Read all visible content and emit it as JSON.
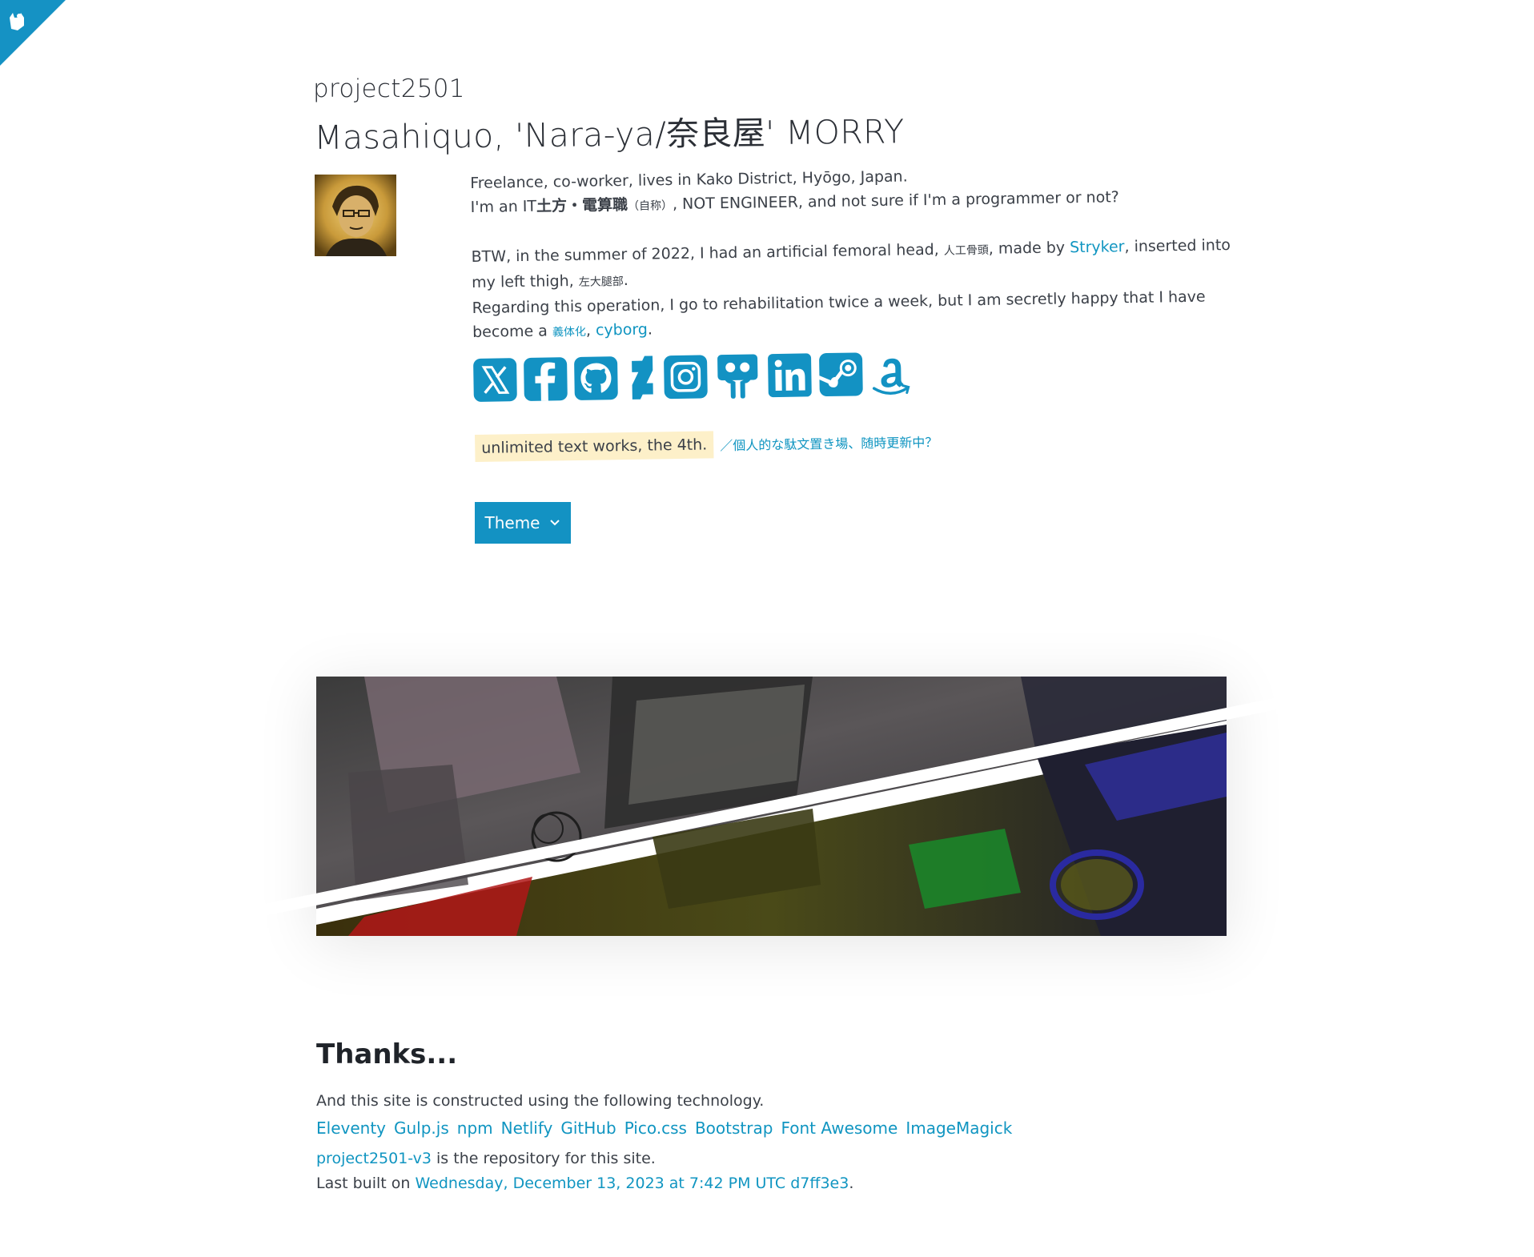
{
  "header": {
    "site_name": "project2501",
    "author_name": "Masahiquo, 'Nara-ya/奈良屋' MORRY"
  },
  "bio": {
    "line1": "Freelance, co-worker, lives in Kako District, Hyōgo, Japan.",
    "line2_a": "I'm an IT",
    "line2_jp": "土方・電算職",
    "line2_small": "（自称）",
    "line2_b": ", NOT ENGINEER, and not sure if I'm a programmer or not?",
    "line3_a": "BTW, in the summer of 2022, I had an artificial femoral head, ",
    "line3_small": "人工骨頭",
    "line3_b": ", made by ",
    "stryker_link": "Stryker",
    "line3_c": ", inserted into my left thigh, ",
    "line3_small2": "左大腿部",
    "line3_d": ".",
    "line4_a": "Regarding this operation, I go to rehabilitation twice a week, but I am secretly happy that I have become a ",
    "line4_small_link": "義体化",
    "line4_b": ", ",
    "cyborg_link": "cyborg",
    "line4_c": "."
  },
  "socials": [
    "x-icon",
    "facebook-icon",
    "github-icon",
    "deviantart-icon",
    "instagram-icon",
    "slideshare-icon",
    "linkedin-icon",
    "steam-icon",
    "amazon-icon"
  ],
  "note": {
    "highlight": "unlimited text works, the 4th.",
    "link": "／個人的な駄文置き場、随時更新中？"
  },
  "theme_button": {
    "label": "Theme"
  },
  "thanks": {
    "title": "Thanks...",
    "text": "And this site is constructed using the following technology.",
    "technologies": [
      "Eleventy",
      "Gulp.js",
      "npm",
      "Netlify",
      "GitHub",
      "Pico.css",
      "Bootstrap",
      "Font Awesome",
      "ImageMagick"
    ],
    "repo_link": "project2501-v3",
    "repo_text": " is the repository for this site.",
    "built_prefix": "Last built on ",
    "built_link": "Wednesday, December 13, 2023 at 7:42 PM UTC d7ff3e3",
    "built_suffix": "."
  },
  "colors": {
    "accent": "#1095c1",
    "button": "#1392c3",
    "highlight": "#fdf0c9",
    "text": "#3b4048"
  }
}
